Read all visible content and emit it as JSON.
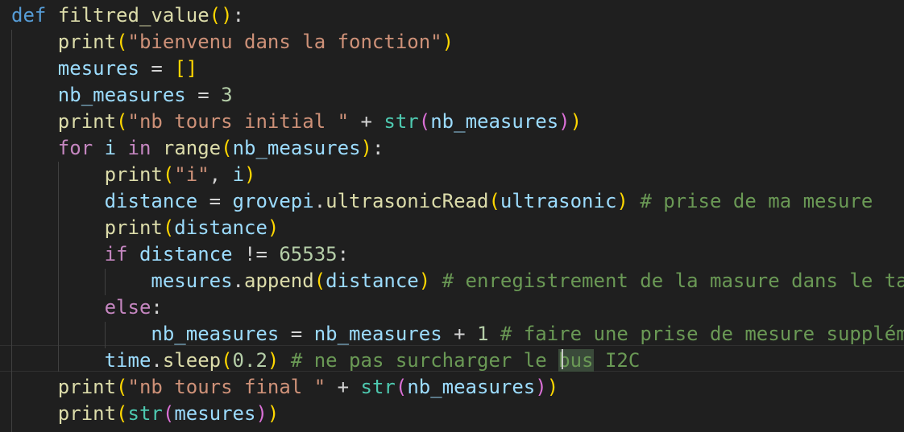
{
  "editor": {
    "language": "python",
    "theme_colors": {
      "background": "#1f1f1f",
      "keyword_blue": "#569cd6",
      "keyword_purple": "#c586c0",
      "function": "#dcdcaa",
      "variable": "#9cdcfe",
      "string": "#ce9178",
      "number": "#b5cea8",
      "comment": "#6a9955",
      "builtin_type": "#4ec9b0",
      "bracket_gold": "#ffd700",
      "bracket_purple": "#da70d6",
      "bracket_blue": "#179fff",
      "text": "#d4d4d4"
    },
    "lines": [
      [
        {
          "t": "def",
          "c": "keyword_blue"
        },
        {
          "t": " ",
          "c": "text"
        },
        {
          "t": "filtred_value",
          "c": "function"
        },
        {
          "t": "()",
          "c": "bracket_gold"
        },
        {
          "t": ":",
          "c": "text"
        }
      ],
      [
        {
          "t": "    ",
          "c": "text"
        },
        {
          "t": "print",
          "c": "function"
        },
        {
          "t": "(",
          "c": "bracket_gold"
        },
        {
          "t": "\"bienvenu dans la fonction\"",
          "c": "string"
        },
        {
          "t": ")",
          "c": "bracket_gold"
        }
      ],
      [
        {
          "t": "    ",
          "c": "text"
        },
        {
          "t": "mesures",
          "c": "variable"
        },
        {
          "t": " = ",
          "c": "text"
        },
        {
          "t": "[]",
          "c": "bracket_gold"
        }
      ],
      [
        {
          "t": "    ",
          "c": "text"
        },
        {
          "t": "nb_measures",
          "c": "variable"
        },
        {
          "t": " = ",
          "c": "text"
        },
        {
          "t": "3",
          "c": "number"
        }
      ],
      [
        {
          "t": "    ",
          "c": "text"
        },
        {
          "t": "print",
          "c": "function"
        },
        {
          "t": "(",
          "c": "bracket_gold"
        },
        {
          "t": "\"nb tours initial \"",
          "c": "string"
        },
        {
          "t": " + ",
          "c": "text"
        },
        {
          "t": "str",
          "c": "builtin_type"
        },
        {
          "t": "(",
          "c": "bracket_purple"
        },
        {
          "t": "nb_measures",
          "c": "variable"
        },
        {
          "t": ")",
          "c": "bracket_purple"
        },
        {
          "t": ")",
          "c": "bracket_gold"
        }
      ],
      [
        {
          "t": "    ",
          "c": "text"
        },
        {
          "t": "for",
          "c": "keyword_purple"
        },
        {
          "t": " ",
          "c": "text"
        },
        {
          "t": "i",
          "c": "variable"
        },
        {
          "t": " ",
          "c": "text"
        },
        {
          "t": "in",
          "c": "keyword_purple"
        },
        {
          "t": " ",
          "c": "text"
        },
        {
          "t": "range",
          "c": "function"
        },
        {
          "t": "(",
          "c": "bracket_gold"
        },
        {
          "t": "nb_measures",
          "c": "variable"
        },
        {
          "t": ")",
          "c": "bracket_gold"
        },
        {
          "t": ":",
          "c": "text"
        }
      ],
      [
        {
          "t": "        ",
          "c": "text"
        },
        {
          "t": "print",
          "c": "function"
        },
        {
          "t": "(",
          "c": "bracket_gold"
        },
        {
          "t": "\"i\"",
          "c": "string"
        },
        {
          "t": ", ",
          "c": "text"
        },
        {
          "t": "i",
          "c": "variable"
        },
        {
          "t": ")",
          "c": "bracket_gold"
        }
      ],
      [
        {
          "t": "        ",
          "c": "text"
        },
        {
          "t": "distance",
          "c": "variable"
        },
        {
          "t": " = ",
          "c": "text"
        },
        {
          "t": "grovepi",
          "c": "variable"
        },
        {
          "t": ".",
          "c": "text"
        },
        {
          "t": "ultrasonicRead",
          "c": "function"
        },
        {
          "t": "(",
          "c": "bracket_gold"
        },
        {
          "t": "ultrasonic",
          "c": "variable"
        },
        {
          "t": ")",
          "c": "bracket_gold"
        },
        {
          "t": " ",
          "c": "text"
        },
        {
          "t": "# prise de ma mesure",
          "c": "comment"
        }
      ],
      [
        {
          "t": "        ",
          "c": "text"
        },
        {
          "t": "print",
          "c": "function"
        },
        {
          "t": "(",
          "c": "bracket_gold"
        },
        {
          "t": "distance",
          "c": "variable"
        },
        {
          "t": ")",
          "c": "bracket_gold"
        }
      ],
      [
        {
          "t": "        ",
          "c": "text"
        },
        {
          "t": "if",
          "c": "keyword_purple"
        },
        {
          "t": " ",
          "c": "text"
        },
        {
          "t": "distance",
          "c": "variable"
        },
        {
          "t": " != ",
          "c": "text"
        },
        {
          "t": "65535",
          "c": "number"
        },
        {
          "t": ":",
          "c": "text"
        }
      ],
      [
        {
          "t": "            ",
          "c": "text"
        },
        {
          "t": "mesures",
          "c": "variable"
        },
        {
          "t": ".",
          "c": "text"
        },
        {
          "t": "append",
          "c": "function"
        },
        {
          "t": "(",
          "c": "bracket_gold"
        },
        {
          "t": "distance",
          "c": "variable"
        },
        {
          "t": ")",
          "c": "bracket_gold"
        },
        {
          "t": " ",
          "c": "text"
        },
        {
          "t": "# enregistrement de la masure dans le ta",
          "c": "comment"
        }
      ],
      [
        {
          "t": "        ",
          "c": "text"
        },
        {
          "t": "else",
          "c": "keyword_purple"
        },
        {
          "t": ":",
          "c": "text"
        }
      ],
      [
        {
          "t": "            ",
          "c": "text"
        },
        {
          "t": "nb_measures",
          "c": "variable"
        },
        {
          "t": " = ",
          "c": "text"
        },
        {
          "t": "nb_measures",
          "c": "variable"
        },
        {
          "t": " + ",
          "c": "text"
        },
        {
          "t": "1",
          "c": "number"
        },
        {
          "t": " ",
          "c": "text"
        },
        {
          "t": "# faire une prise de mesure supplém",
          "c": "comment"
        }
      ],
      [
        {
          "t": "        ",
          "c": "text"
        },
        {
          "t": "time",
          "c": "variable"
        },
        {
          "t": ".",
          "c": "text"
        },
        {
          "t": "sleep",
          "c": "function"
        },
        {
          "t": "(",
          "c": "bracket_gold"
        },
        {
          "t": "0.2",
          "c": "number"
        },
        {
          "t": ")",
          "c": "bracket_gold"
        },
        {
          "t": " ",
          "c": "text"
        },
        {
          "t": "# ne pas surcharger le ",
          "c": "comment"
        },
        {
          "t": "bus",
          "c": "comment",
          "hl": true
        },
        {
          "t": " I2C",
          "c": "comment"
        }
      ],
      [
        {
          "t": "    ",
          "c": "text"
        },
        {
          "t": "print",
          "c": "function"
        },
        {
          "t": "(",
          "c": "bracket_gold"
        },
        {
          "t": "\"nb tours final \"",
          "c": "string"
        },
        {
          "t": " + ",
          "c": "text"
        },
        {
          "t": "str",
          "c": "builtin_type"
        },
        {
          "t": "(",
          "c": "bracket_purple"
        },
        {
          "t": "nb_measures",
          "c": "variable"
        },
        {
          "t": ")",
          "c": "bracket_purple"
        },
        {
          "t": ")",
          "c": "bracket_gold"
        }
      ],
      [
        {
          "t": "    ",
          "c": "text"
        },
        {
          "t": "print",
          "c": "function"
        },
        {
          "t": "(",
          "c": "bracket_gold"
        },
        {
          "t": "str",
          "c": "builtin_type"
        },
        {
          "t": "(",
          "c": "bracket_purple"
        },
        {
          "t": "mesures",
          "c": "variable"
        },
        {
          "t": ")",
          "c": "bracket_purple"
        },
        {
          "t": ")",
          "c": "bracket_gold"
        }
      ]
    ]
  }
}
